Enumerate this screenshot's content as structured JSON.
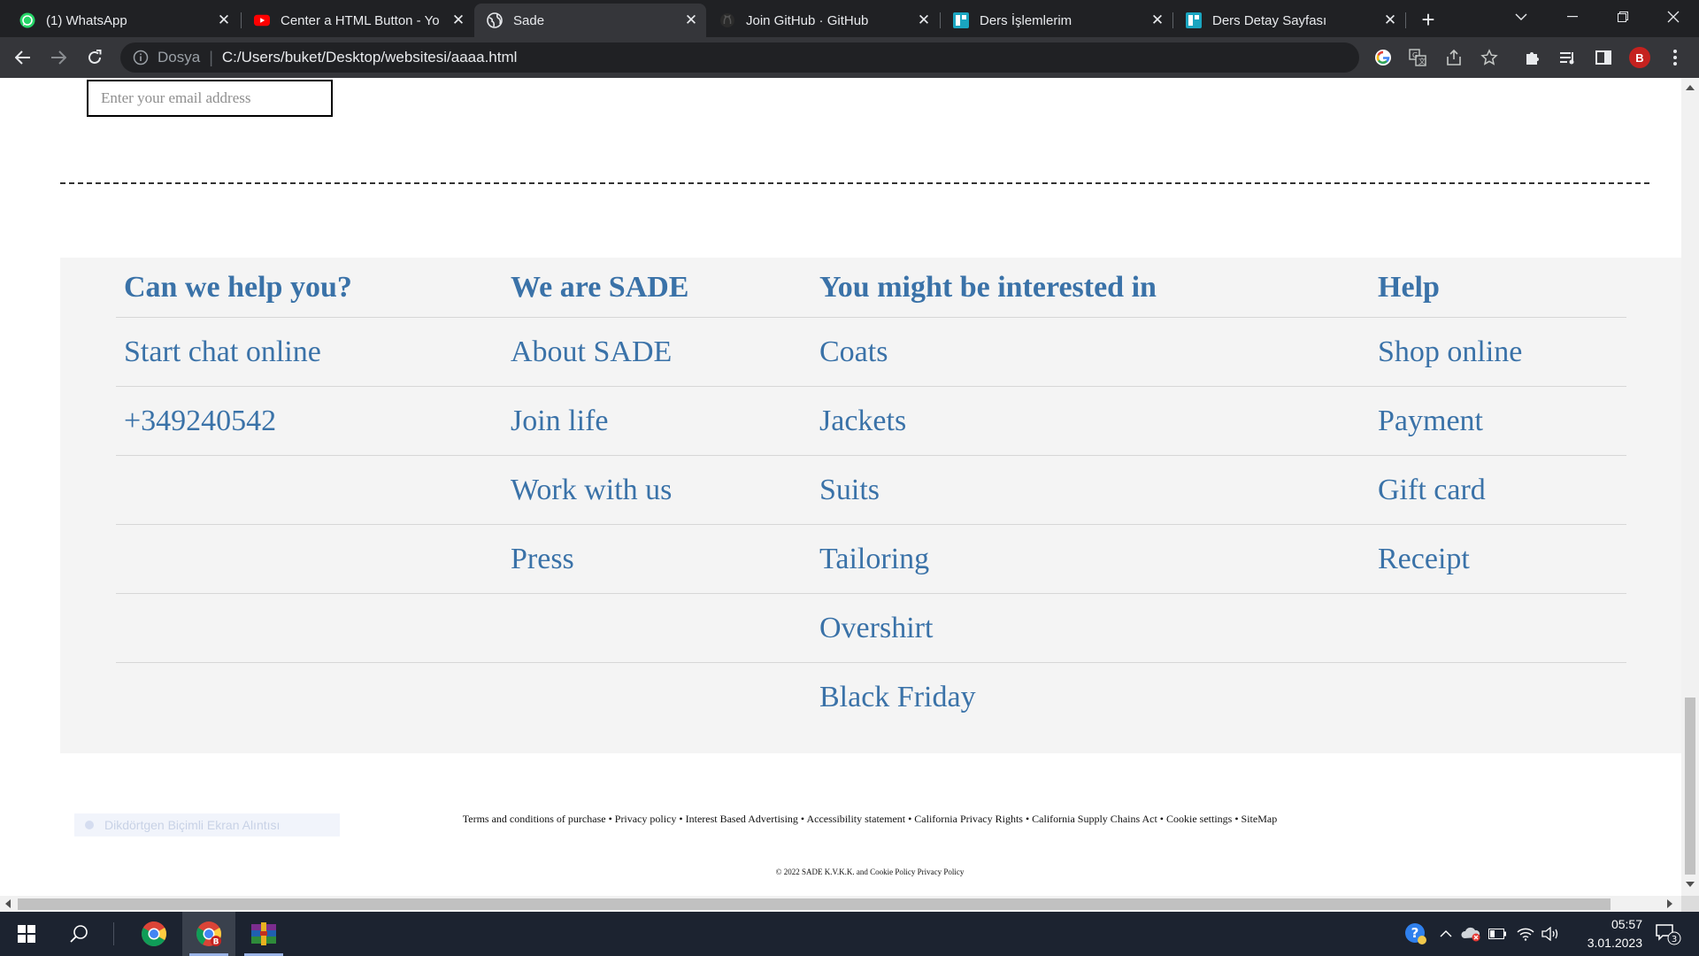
{
  "browser": {
    "tabs": [
      {
        "title": "(1) WhatsApp",
        "icon": "whatsapp-icon",
        "active": false
      },
      {
        "title": "Center a HTML Button - Yo",
        "icon": "youtube-icon",
        "active": false
      },
      {
        "title": "Sade",
        "icon": "globe-icon",
        "active": true
      },
      {
        "title": "Join GitHub · GitHub",
        "icon": "github-icon",
        "active": false
      },
      {
        "title": "Ders İşlemlerim",
        "icon": "site-icon",
        "active": false
      },
      {
        "title": "Ders Detay Sayfası",
        "icon": "site-icon",
        "active": false
      }
    ],
    "address": {
      "scheme_label": "Dosya",
      "url": "C:/Users/buket/Desktop/websitesi/aaaa.html"
    },
    "profile_initial": "B"
  },
  "page": {
    "email_placeholder": "Enter your email address",
    "footer": {
      "columns": [
        {
          "heading": "Can we help you?",
          "items": [
            "Start chat online",
            "+349240542"
          ]
        },
        {
          "heading": "We are SADE",
          "items": [
            "About SADE",
            "Join life",
            "Work with us",
            "Press"
          ]
        },
        {
          "heading": "You might be interested in",
          "items": [
            "Coats",
            "Jackets",
            "Suits",
            "Tailoring",
            "Overshirt",
            "Black Friday"
          ]
        },
        {
          "heading": "Help",
          "items": [
            "Shop online",
            "Payment",
            "Gift card",
            "Receipt"
          ]
        }
      ]
    },
    "legal_links": "Terms and conditions of purchase • Privacy policy • Interest Based Advertising • Accessibility statement • California Privacy Rights • California Supply Chains Act • Cookie settings • SiteMap",
    "copyright": "© 2022 SADE K.V.K.K. and Cookie Policy Privacy Policy",
    "overlay_text": "Dikdörtgen Biçimli Ekran Alıntısı"
  },
  "taskbar": {
    "time": "05:57",
    "date": "3.01.2023",
    "notification_count": "3",
    "chrome_badge": "B"
  },
  "colors": {
    "link_blue": "#3a72a8",
    "footer_bg": "#f4f4f4",
    "chrome_dark": "#202124",
    "taskbar_bg": "#1c2330"
  }
}
